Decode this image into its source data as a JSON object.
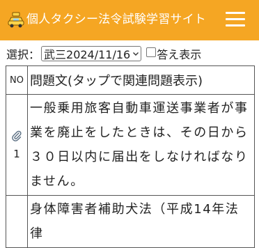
{
  "header": {
    "title": "個人タクシー法令試験学習サイト",
    "icon": "taxi-icon",
    "menu_icon": "hamburger-menu-icon",
    "background": "#f5a623"
  },
  "controls": {
    "select_label": "選択：",
    "selected_exam": "武三2024/11/16",
    "show_answer_label": "答え表示",
    "show_answer_checked": false
  },
  "table": {
    "headers": {
      "no": "NO",
      "question": "問題文(タップで関連問題表示)"
    },
    "rows": [
      {
        "no": "1",
        "has_attachment": true,
        "question": "一般乗用旅客自動車運送事業者が事業を廃止をしたときは、その日から３０日以内に届出をしなければなりません。"
      },
      {
        "no": "",
        "has_attachment": false,
        "question": "身体障害者補助犬法（平成14年法律"
      }
    ]
  }
}
